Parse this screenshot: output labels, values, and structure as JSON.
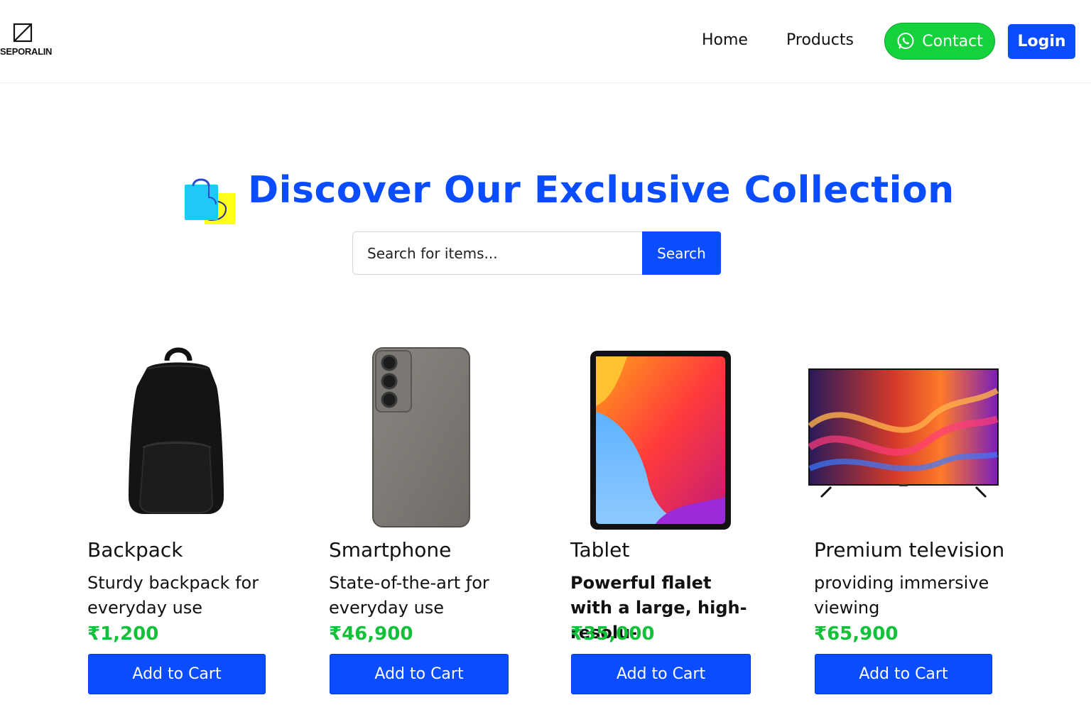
{
  "brand": {
    "logo_text": "SEPORALIN"
  },
  "nav": {
    "home_label": "Home",
    "products_label": "Products",
    "contact_label": "Contact",
    "login_label": "Login"
  },
  "hero": {
    "title": "Discover Our Exclusive Collection",
    "search_placeholder": "Search for items...",
    "search_button": "Search"
  },
  "products": [
    {
      "name": "Backpack",
      "description": "Sturdy backpack for everyday use",
      "price": "₹1,200",
      "button": "Add to Cart",
      "image_icon": "backpack-image"
    },
    {
      "name": "Smartphone",
      "description": "State-of-the-art ƒor everyday use",
      "price": "₹46,900",
      "button": "Add to Cart",
      "image_icon": "smartphone-image"
    },
    {
      "name": "Tablet",
      "description": "Powerful flalet with a large, high-resolu-",
      "price": "₹35,000",
      "button": "Add to Cart",
      "image_icon": "tablet-image"
    },
    {
      "name": "Premium television",
      "description": "providing immersive viewing",
      "price": "₹65,900",
      "button": "Add to Cart",
      "image_icon": "television-image"
    }
  ],
  "colors": {
    "accent": "#0a4cff",
    "contact_green": "#15d13b",
    "price_green": "#13c03a",
    "bag_blue": "#1fc8f5",
    "bag_yellow": "#ffff1a"
  }
}
